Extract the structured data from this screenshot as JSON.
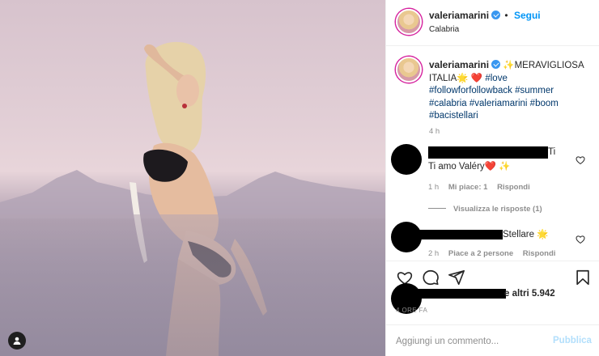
{
  "header": {
    "username": "valeriamarini",
    "follow_label": "Segui",
    "location": "Calabria"
  },
  "caption": {
    "username": "valeriamarini",
    "text_main": "✨MERAVIGLIOSA ITALIA🌟 ❤️",
    "hashtags": [
      "#love",
      "#followforfollowback",
      "#summer",
      "#calabria",
      "#valeriamarini",
      "#boom",
      "#bacistellari"
    ],
    "time": "4 h"
  },
  "comments": [
    {
      "text_visible": "Ti amo Valéry❤️ ✨",
      "time": "1 h",
      "likes": "Mi piace: 1",
      "reply_label": "Rispondi"
    },
    {
      "text_visible": "Stellare 🌟",
      "time": "2 h",
      "likes": "Piace a 2 persone",
      "reply_label": "Rispondi"
    }
  ],
  "view_replies": "Visualizza le risposte (1)",
  "likes_summary": "e altri 5.942",
  "post_timestamp": "4 ORE FA",
  "add_comment": {
    "placeholder": "Aggiungi un commento...",
    "post_label": "Pubblica"
  },
  "colors": {
    "accent": "#0095f6",
    "hashtag": "#00376b",
    "muted": "#8e8e8e",
    "post_disabled": "#b2dffc"
  },
  "icons": [
    "heart-icon",
    "comment-icon",
    "share-icon",
    "bookmark-icon",
    "user-tag-icon",
    "verified-icon"
  ]
}
